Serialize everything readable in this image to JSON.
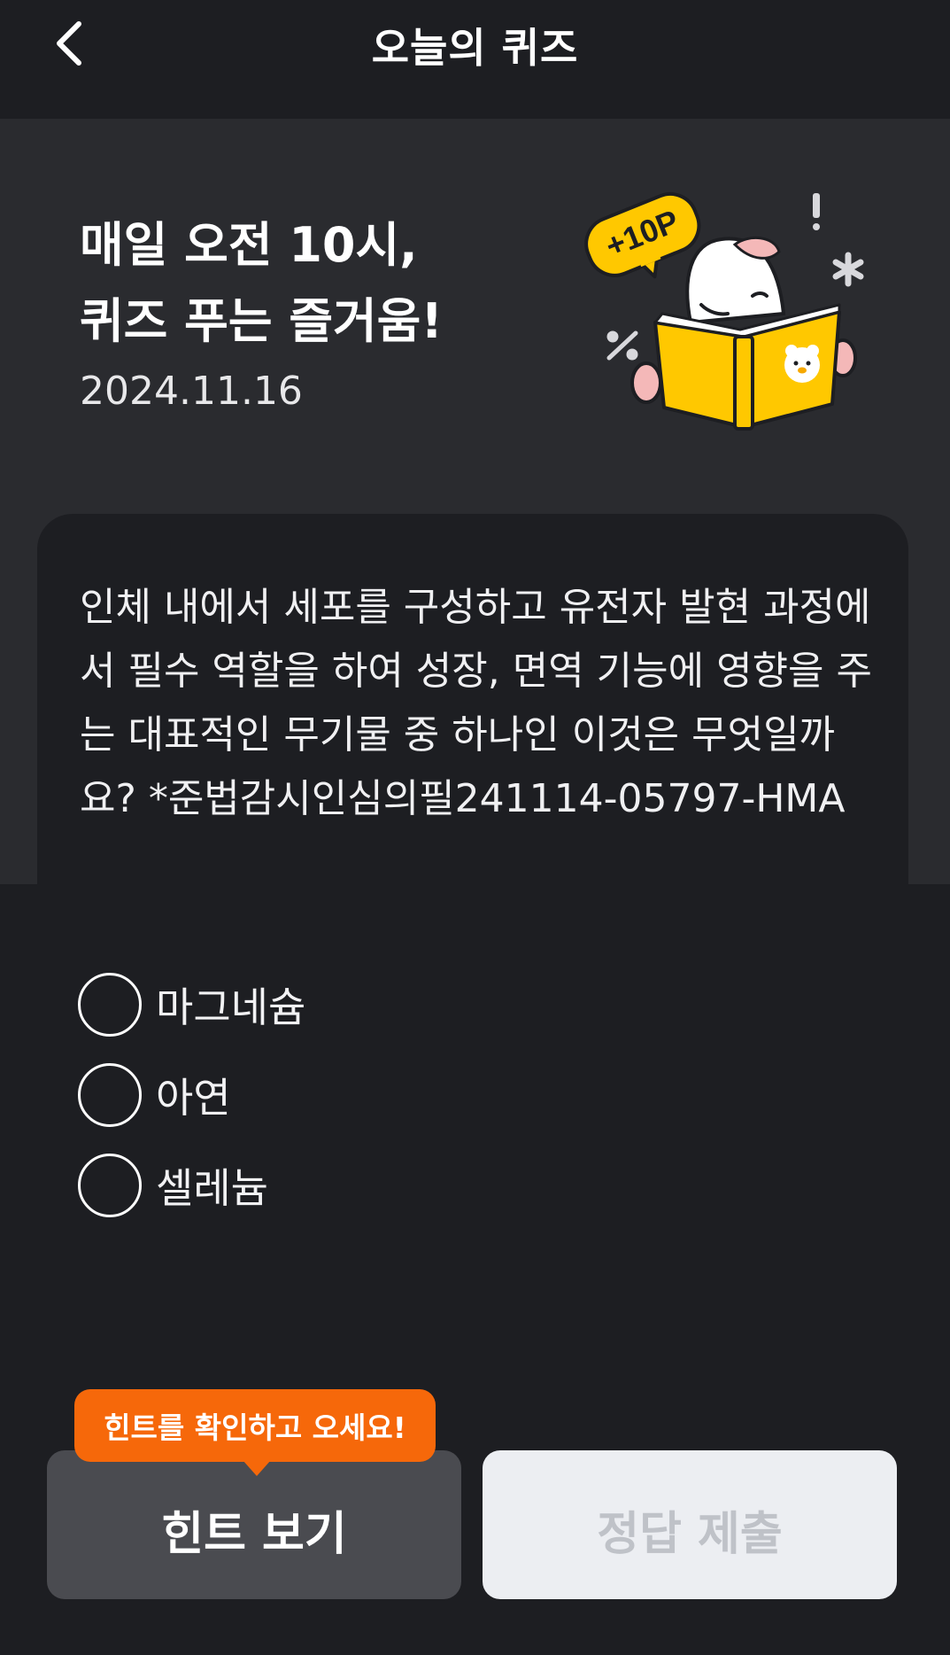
{
  "header": {
    "title": "오늘의 퀴즈",
    "back_icon": "chevron-left-icon"
  },
  "hero": {
    "title_line1": "매일 오전 10시,",
    "title_line2": "퀴즈 푸는 즐거움!",
    "date": "2024.11.16",
    "badge_text": "+10P",
    "accent_color": "#ffc800"
  },
  "question": {
    "text": "인체 내에서 세포를 구성하고 유전자 발현 과정에서 필수 역할을 하여 성장, 면역 기능에 영향을 주는 대표적인 무기물 중 하나인 이것은 무엇일까요? *준법감시인심의필241114-05797-HMA"
  },
  "options": [
    {
      "label": "마그네슘"
    },
    {
      "label": "아연"
    },
    {
      "label": "셀레늄"
    }
  ],
  "actions": {
    "hint_tooltip": "힌트를 확인하고 오세요!",
    "hint_button": "힌트 보기",
    "submit_button": "정답 제출",
    "tooltip_color": "#f6680a"
  }
}
